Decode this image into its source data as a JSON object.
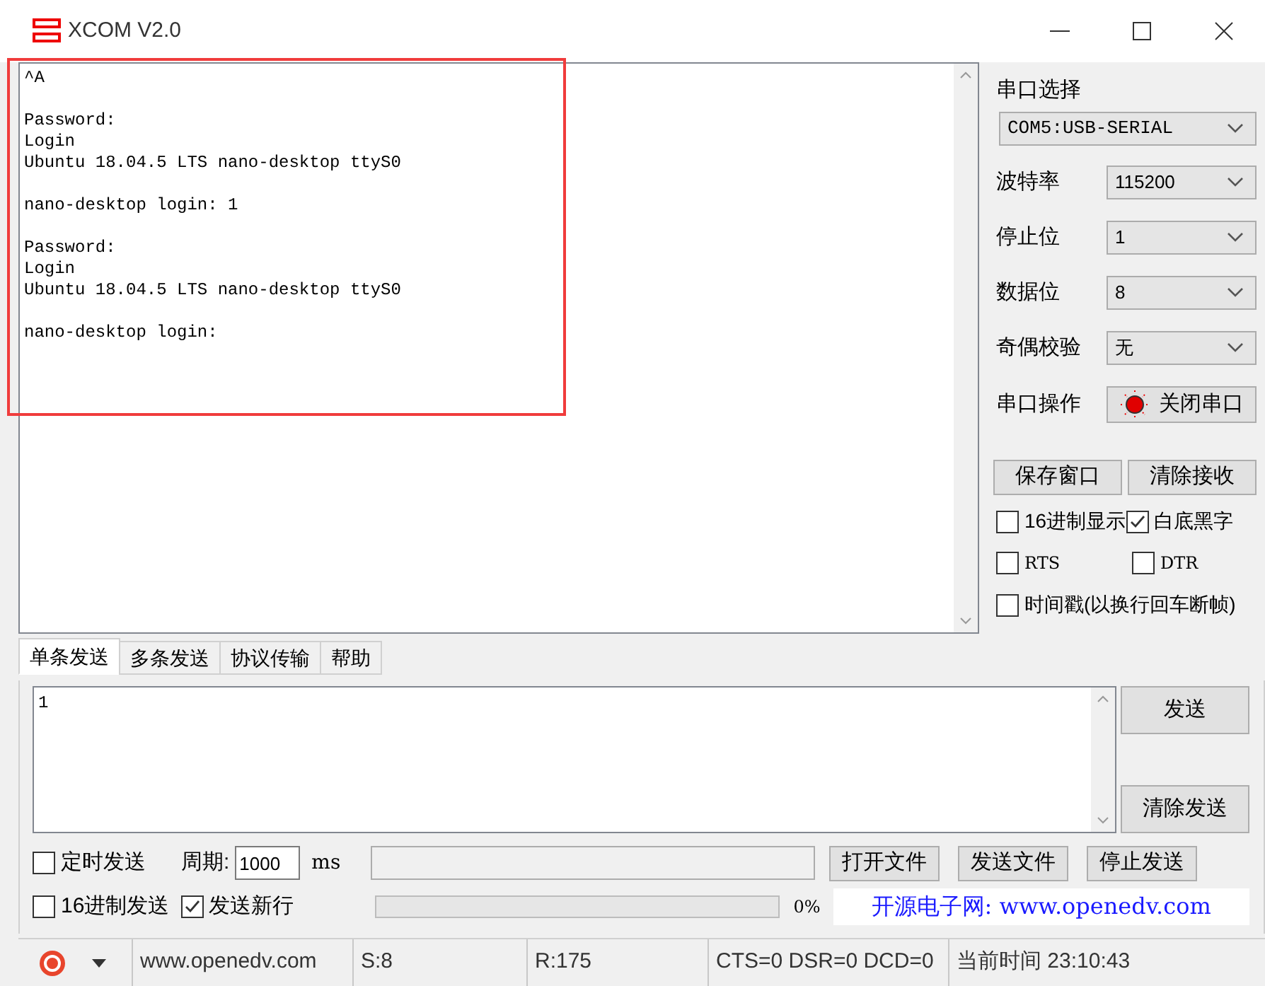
{
  "window": {
    "title": "XCOM V2.0"
  },
  "receive": {
    "text": "^A\n\nPassword:\nLogin\nUbuntu 18.04.5 LTS nano-desktop ttyS0\n\nnano-desktop login: 1\n\nPassword:\nLogin\nUbuntu 18.04.5 LTS nano-desktop ttyS0\n\nnano-desktop login:",
    "highlighted": true
  },
  "port_panel": {
    "title": "串口选择",
    "port": "COM5:USB-SERIAL",
    "settings": [
      {
        "label": "波特率",
        "value": "115200"
      },
      {
        "label": "停止位",
        "value": "1"
      },
      {
        "label": "数据位",
        "value": "8"
      },
      {
        "label": "奇偶校验",
        "value": "无"
      }
    ],
    "operation_label": "串口操作",
    "operation_button": "关闭串口",
    "port_open": true,
    "buttons": [
      "保存窗口",
      "清除接收"
    ],
    "options": [
      {
        "label": "16进制显示",
        "checked": false
      },
      {
        "label": "白底黑字",
        "checked": true
      },
      {
        "label": "RTS",
        "checked": false
      },
      {
        "label": "DTR",
        "checked": false
      },
      {
        "label": "时间戳(以换行回车断帧)",
        "checked": false
      }
    ]
  },
  "tabs": [
    {
      "label": "单条发送",
      "selected": true
    },
    {
      "label": "多条发送",
      "selected": false
    },
    {
      "label": "协议传输",
      "selected": false
    },
    {
      "label": "帮助",
      "selected": false
    }
  ],
  "send": {
    "text": "1",
    "buttons": [
      "发送",
      "清除发送"
    ]
  },
  "timed_send": {
    "label": "定时发送",
    "checked": false
  },
  "period": {
    "label": "周期:",
    "value": "1000",
    "unit": "ms"
  },
  "hex_send": {
    "label": "16进制发送",
    "checked": false
  },
  "newline": {
    "label": "发送新行",
    "checked": true
  },
  "file_buttons": [
    "打开文件",
    "发送文件",
    "停止发送"
  ],
  "progress": {
    "level": 0,
    "reading": "0%"
  },
  "banner": "开源电子网: www.openedv.com",
  "status_bar": [
    "www.openedv.com",
    "S:8",
    "R:175",
    "CTS=0 DSR=0 DCD=0",
    "当前时间 23:10:43"
  ]
}
